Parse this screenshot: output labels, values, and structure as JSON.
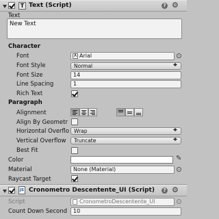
{
  "text_component": {
    "title": "Text (Script)",
    "enabled": true,
    "text_label": "Text",
    "text_value": "New Text",
    "character_section": "Character",
    "font_label": "Font",
    "font_value": "Arial",
    "font_style_label": "Font Style",
    "font_style_value": "Normal",
    "font_size_label": "Font Size",
    "font_size_value": "14",
    "line_spacing_label": "Line Spacing",
    "line_spacing_value": "1",
    "rich_text_label": "Rich Text",
    "rich_text_checked": true,
    "paragraph_section": "Paragraph",
    "alignment_label": "Alignment",
    "align_by_geometry_label": "Align By Geometr",
    "align_by_geometry_checked": false,
    "horizontal_overflow_label": "Horizontal Overflo",
    "horizontal_overflow_value": "Wrap",
    "vertical_overflow_label": "Vertical Overflow",
    "vertical_overflow_value": "Truncate",
    "best_fit_label": "Best Fit",
    "best_fit_checked": false,
    "color_label": "Color",
    "color_value": "#ffffff",
    "material_label": "Material",
    "material_value": "None (Material)",
    "raycast_target_label": "Raycast Target",
    "raycast_target_checked": true
  },
  "script_component": {
    "title": "Cronometro Descentente_UI (Script)",
    "enabled": true,
    "script_label": "Script",
    "script_value": "CronometroDescentente_UI",
    "count_down_label": "Count Down Second",
    "count_down_value": "10"
  },
  "icons": [
    "fold-arrow-icon",
    "text-component-icon",
    "help-icon",
    "gear-icon",
    "font-asset-icon",
    "object-picker-icon",
    "eyedropper-icon",
    "script-file-icon"
  ]
}
